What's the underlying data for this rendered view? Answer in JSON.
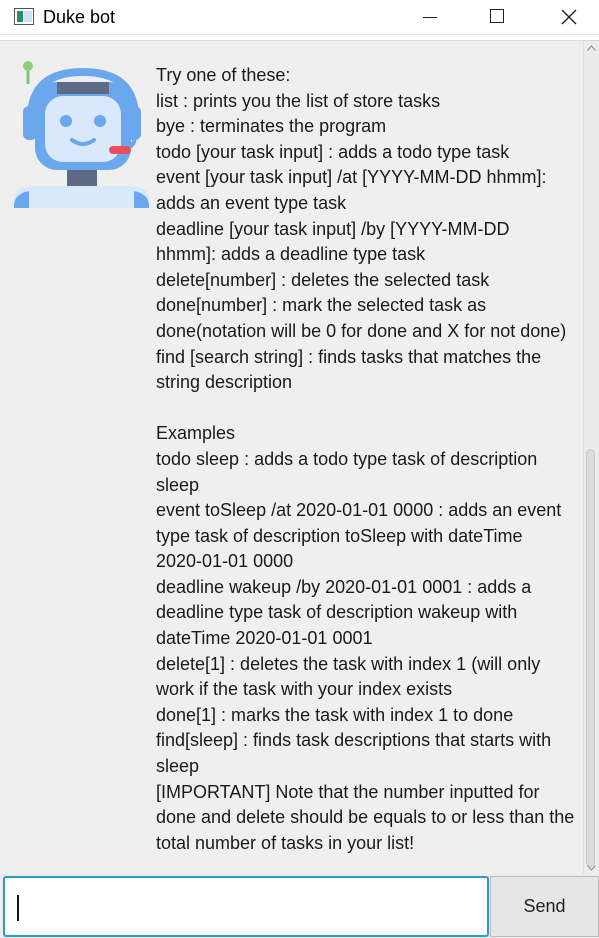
{
  "window": {
    "title": "Duke bot",
    "controls": [
      "minimize",
      "maximize",
      "close"
    ]
  },
  "dialog": {
    "avatar_icon": "robot-avatar-icon",
    "message": "Try one of these:\nlist : prints you the list of store tasks\nbye : terminates the program\ntodo [your task input] : adds a todo type task\nevent [your task input] /at [YYYY-MM-DD hhmm]:\nadds an event type task\ndeadline [your task input] /by [YYYY-MM-DD\nhhmm]: adds a deadline type task\ndelete[number] : deletes the selected task\ndone[number] : mark the selected task as\ndone(notation will be 0 for done and X for not done)\nfind [search string] : finds tasks that matches the\nstring description\n\nExamples\ntodo sleep : adds a todo type task of description\nsleep\nevent toSleep /at 2020-01-01 0000 : adds an event\ntype task of description toSleep with dateTime\n2020-01-01 0000\ndeadline wakeup /by 2020-01-01 0001 : adds a\ndeadline type task of description wakeup with\ndateTime 2020-01-01 0001\ndelete[1] : deletes the task with index 1 (will only\nwork if the task with your index exists\ndone[1] : marks the task with index 1 to done\nfind[sleep] : finds task descriptions that starts with\nsleep\n[IMPORTANT] Note that the number inputted for\ndone and delete should be equals to or less than the\ntotal number of tasks in your list!"
  },
  "input": {
    "value": "",
    "placeholder": ""
  },
  "send_button": {
    "label": "Send"
  },
  "colors": {
    "input_focus_border": "#2f9bc4",
    "dialog_background": "#efefef",
    "avatar_accent": "#64a4ec",
    "headset_mic": "#e94e5b"
  }
}
